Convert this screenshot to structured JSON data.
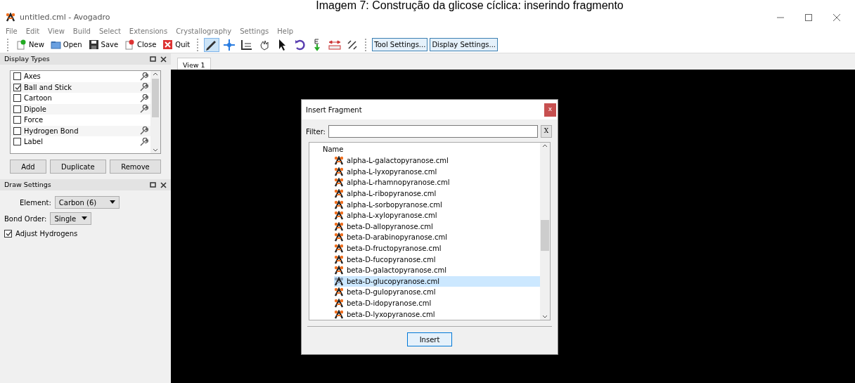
{
  "caption": "Imagem 7: Construção da glicose cíclica: inserindo fragmento",
  "window": {
    "title": "untitled.cml - Avogadro"
  },
  "menu": [
    "File",
    "Edit",
    "View",
    "Build",
    "Select",
    "Extensions",
    "Crystallography",
    "Settings",
    "Help"
  ],
  "toolbar": {
    "actions": [
      {
        "kind": "new",
        "label": "New"
      },
      {
        "kind": "open",
        "label": "Open"
      },
      {
        "kind": "save",
        "label": "Save"
      },
      {
        "kind": "close",
        "label": "Close"
      },
      {
        "kind": "quit",
        "label": "Quit"
      }
    ],
    "tools": [
      {
        "kind": "draw",
        "selected": true
      },
      {
        "kind": "navigate",
        "selected": false
      },
      {
        "kind": "measure",
        "selected": false
      },
      {
        "kind": "manipulate",
        "selected": false
      },
      {
        "kind": "select",
        "selected": false
      },
      {
        "kind": "rotate",
        "selected": false
      },
      {
        "kind": "optimize",
        "selected": false
      },
      {
        "kind": "ruler",
        "selected": false
      },
      {
        "kind": "align",
        "selected": false
      }
    ],
    "buttons": [
      "Tool Settings...",
      "Display Settings..."
    ]
  },
  "display_types": {
    "title": "Display Types",
    "items": [
      {
        "label": "Axes",
        "checked": false,
        "has_settings": true
      },
      {
        "label": "Ball and Stick",
        "checked": true,
        "has_settings": true
      },
      {
        "label": "Cartoon",
        "checked": false,
        "has_settings": true
      },
      {
        "label": "Dipole",
        "checked": false,
        "has_settings": true
      },
      {
        "label": "Force",
        "checked": false,
        "has_settings": false
      },
      {
        "label": "Hydrogen Bond",
        "checked": false,
        "has_settings": true
      },
      {
        "label": "Label",
        "checked": false,
        "has_settings": true
      }
    ],
    "buttons": [
      "Add",
      "Duplicate",
      "Remove"
    ]
  },
  "draw_settings": {
    "title": "Draw Settings",
    "element_label": "Element:",
    "element": "Carbon (6)",
    "bond_order_label": "Bond Order:",
    "bond_order": "Single",
    "adjust_hydrogens": {
      "label": "Adjust Hydrogens",
      "checked": true
    }
  },
  "tabs": [
    {
      "label": "View 1",
      "selected": true
    }
  ],
  "dialog": {
    "title": "Insert Fragment",
    "close": "x",
    "filter_label": "Filter:",
    "filter_clear": "X",
    "column": "Name",
    "items": [
      {
        "label": "alpha-L-galactopyranose.cml",
        "selected": false
      },
      {
        "label": "alpha-L-lyxopyranose.cml",
        "selected": false
      },
      {
        "label": "alpha-L-rhamnopyranose.cml",
        "selected": false
      },
      {
        "label": "alpha-L-ribopyranose.cml",
        "selected": false
      },
      {
        "label": "alpha-L-sorbopyranose.cml",
        "selected": false
      },
      {
        "label": "alpha-L-xylopyranose.cml",
        "selected": false
      },
      {
        "label": "beta-D-allopyranose.cml",
        "selected": false
      },
      {
        "label": "beta-D-arabinopyranose.cml",
        "selected": false
      },
      {
        "label": "beta-D-fructopyranose.cml",
        "selected": false
      },
      {
        "label": "beta-D-fucopyranose.cml",
        "selected": false
      },
      {
        "label": "beta-D-galactopyranose.cml",
        "selected": false
      },
      {
        "label": "beta-D-glucopyranose.cml",
        "selected": true
      },
      {
        "label": "beta-D-gulopyranose.cml",
        "selected": false
      },
      {
        "label": "beta-D-idopyranose.cml",
        "selected": false
      },
      {
        "label": "beta-D-lyxopyranose.cml",
        "selected": false
      }
    ],
    "button": "Insert"
  }
}
